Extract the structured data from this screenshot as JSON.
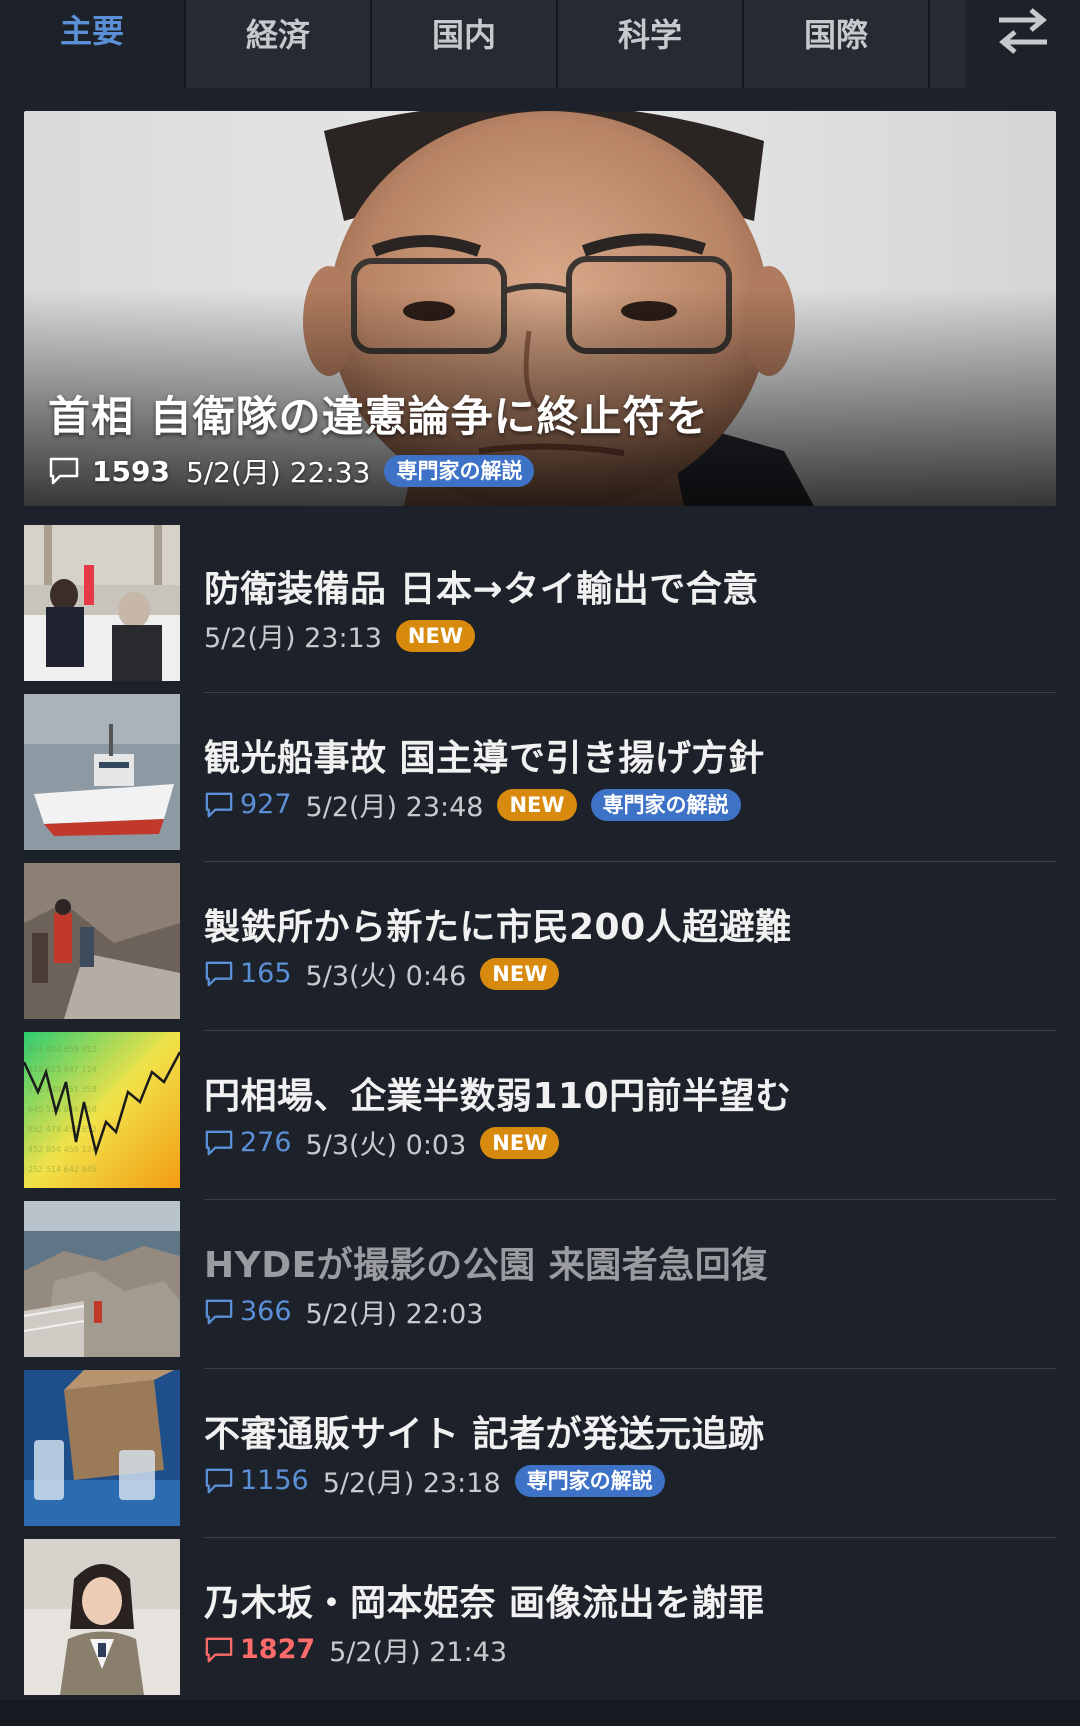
{
  "tabs": [
    {
      "label": "主要",
      "active": true
    },
    {
      "label": "経済",
      "active": false
    },
    {
      "label": "国内",
      "active": false
    },
    {
      "label": "科学",
      "active": false
    },
    {
      "label": "国際",
      "active": false
    }
  ],
  "swap_icon": "swap-arrows-icon",
  "hero": {
    "title": "首相 自衛隊の違憲論争に終止符を",
    "comment_count": "1593",
    "date": "5/2(月) 22:33",
    "badge_expert": "専門家の解説"
  },
  "articles": [
    {
      "title": "防衛装備品 日本→タイ輸出で合意",
      "comment_count": "",
      "date": "5/2(月) 23:13",
      "badge_new": "NEW",
      "badge_expert": ""
    },
    {
      "title": "観光船事故 国主導で引き揚げ方針",
      "comment_count": "927",
      "date": "5/2(月) 23:48",
      "badge_new": "NEW",
      "badge_expert": "専門家の解説"
    },
    {
      "title": "製鉄所から新たに市民200人超避難",
      "comment_count": "165",
      "date": "5/3(火) 0:46",
      "badge_new": "NEW",
      "badge_expert": ""
    },
    {
      "title": "円相場、企業半数弱110円前半望む",
      "comment_count": "276",
      "date": "5/3(火) 0:03",
      "badge_new": "NEW",
      "badge_expert": ""
    },
    {
      "title": "HYDEが撮影の公園 来園者急回復",
      "comment_count": "366",
      "date": "5/2(月) 22:03",
      "badge_new": "",
      "badge_expert": ""
    },
    {
      "title": "不審通販サイト 記者が発送元追跡",
      "comment_count": "1156",
      "date": "5/2(月) 23:18",
      "badge_new": "",
      "badge_expert": "専門家の解説"
    },
    {
      "title": "乃木坂・岡本姫奈 画像流出を謝罪",
      "comment_count": "1827",
      "date": "5/2(月) 21:43",
      "badge_new": "",
      "badge_expert": ""
    }
  ],
  "colors": {
    "background": "#1d2129",
    "accent_blue": "#5b8fd6",
    "badge_new": "#d88a0e",
    "badge_expert": "#3d72c7",
    "hot_count": "#ff6b6b"
  }
}
